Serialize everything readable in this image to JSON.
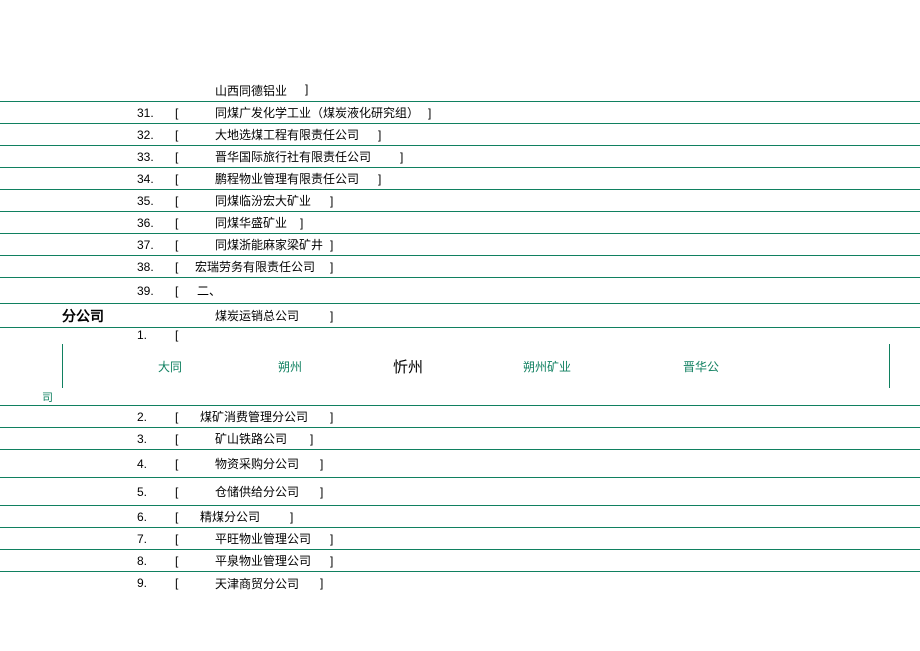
{
  "items_top": [
    {
      "num": "31.",
      "text": "山西同德铝业"
    },
    {
      "num": "32.",
      "text": "同煤广发化学工业（煤炭液化研究组）"
    },
    {
      "num": "33.",
      "text": "大地选煤工程有限责任公司"
    },
    {
      "num": "34.",
      "text": "晋华国际旅行社有限责任公司"
    },
    {
      "num": "35.",
      "text": "鹏程物业管理有限责任公司"
    },
    {
      "num": "36.",
      "text": "同煤临汾宏大矿业"
    },
    {
      "num": "37.",
      "text": "同煤华盛矿业"
    },
    {
      "num": "38.",
      "text": "同煤浙能麻家梁矿井"
    },
    {
      "num": "39.",
      "text": "宏瑞劳务有限责任公司"
    }
  ],
  "section_label": "二、",
  "section_title": "分公司",
  "sub_first": {
    "num": "1.",
    "text": "煤炭运销总公司"
  },
  "sub_links": [
    {
      "label": "大同",
      "class": ""
    },
    {
      "label": "朔州",
      "class": ""
    },
    {
      "label": "忻州",
      "class": "special"
    },
    {
      "label": "朔州矿业",
      "class": ""
    },
    {
      "label": "晋华公",
      "class": ""
    }
  ],
  "tail_label": "司",
  "items_bottom": [
    {
      "num": "2.",
      "text": "煤矿消费管理分公司"
    },
    {
      "num": "3.",
      "text": "矿山铁路公司"
    },
    {
      "num": "4.",
      "text": "物资采购分公司"
    },
    {
      "num": "5.",
      "text": "仓储供给分公司"
    },
    {
      "num": "6.",
      "text": "精煤分公司"
    },
    {
      "num": "7.",
      "text": "平旺物业管理公司"
    },
    {
      "num": "8.",
      "text": "平泉物业管理公司"
    },
    {
      "num": "9.",
      "text": "天津商贸分公司"
    }
  ]
}
